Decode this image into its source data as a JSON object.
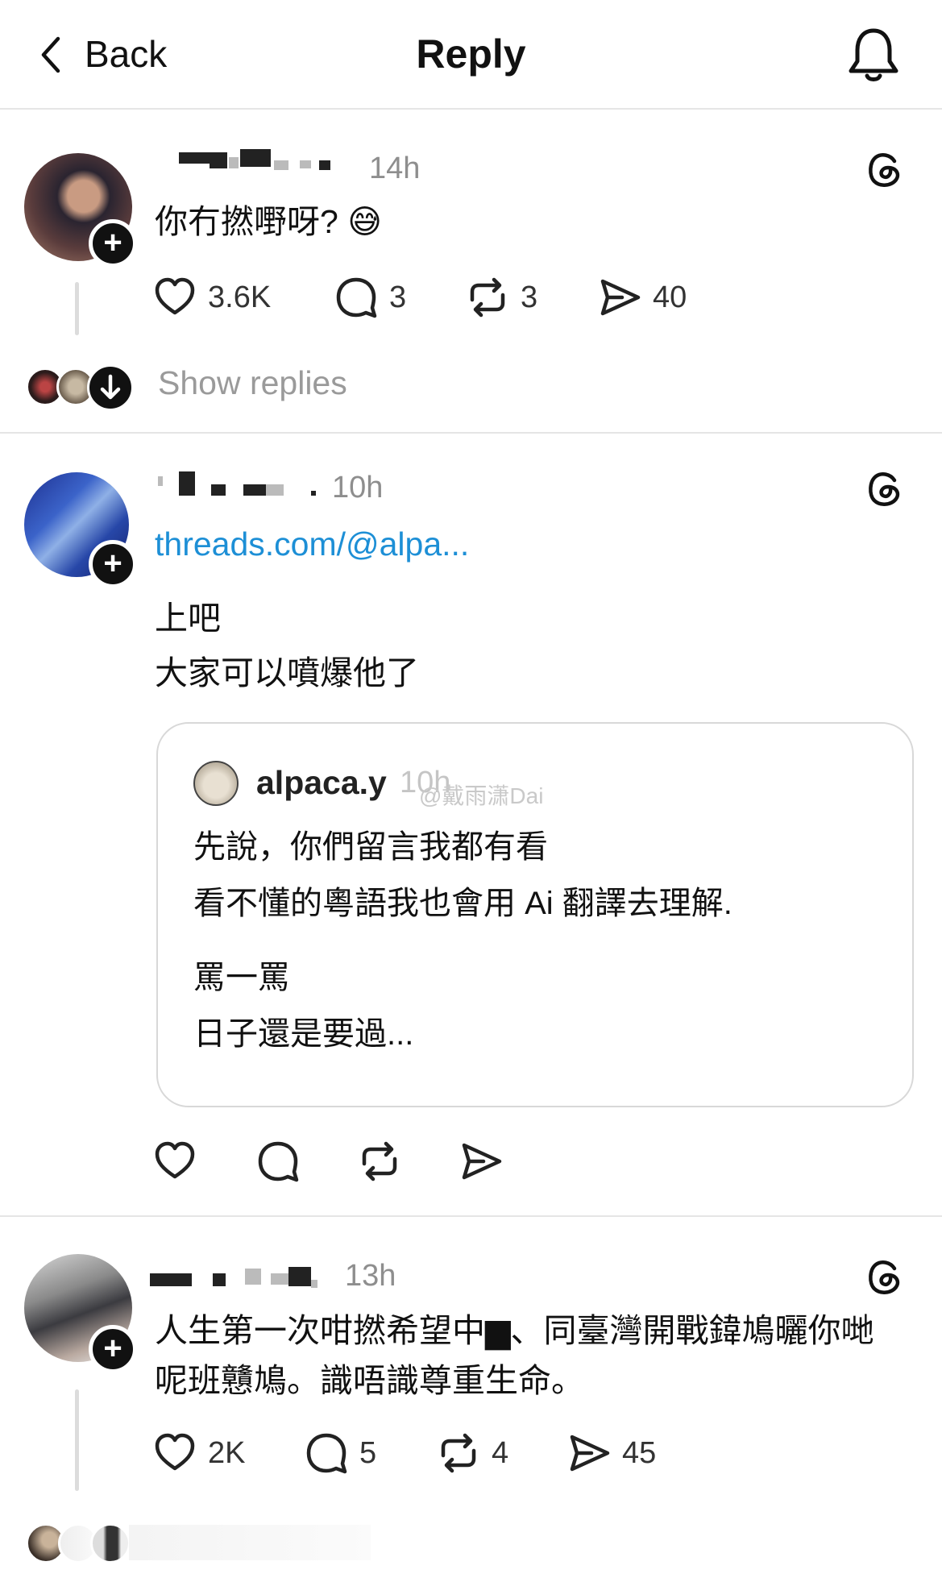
{
  "header": {
    "back_label": "Back",
    "title": "Reply"
  },
  "posts": [
    {
      "time": "14h",
      "text": "你冇撚嘢呀? 😅",
      "likes": "3.6K",
      "comments": "3",
      "reposts": "3",
      "shares": "40",
      "show_replies": "Show replies"
    },
    {
      "time": "10h",
      "link": "threads.com/@alpa...",
      "lines": [
        "上吧",
        "大家可以噴爆他了"
      ],
      "quote": {
        "username": "alpaca.y",
        "time": "10h",
        "paragraph1": [
          "先說，你們留言我都有看",
          "看不懂的粵語我也會用 Ai 翻譯去理解."
        ],
        "paragraph2": [
          "罵一罵",
          "日子還是要過..."
        ]
      },
      "watermark": "@戴雨潇Dai"
    },
    {
      "time": "13h",
      "lines": [
        "人生第一次咁撚希望中▆、同臺灣開戰鍏鳩曬你哋",
        "呢班戇鳩。識唔識尊重生命。"
      ],
      "likes": "2K",
      "comments": "5",
      "reposts": "4",
      "shares": "45"
    }
  ],
  "icons": {
    "back": "chevron-left-icon",
    "bell": "bell-icon",
    "threads": "threads-logo-icon",
    "like": "heart-icon",
    "comment": "comment-bubble-icon",
    "repost": "repost-icon",
    "share": "send-icon"
  },
  "colors": {
    "link": "#1d8fd6",
    "muted": "#8e8e8e",
    "divider": "#e5e5e5"
  }
}
